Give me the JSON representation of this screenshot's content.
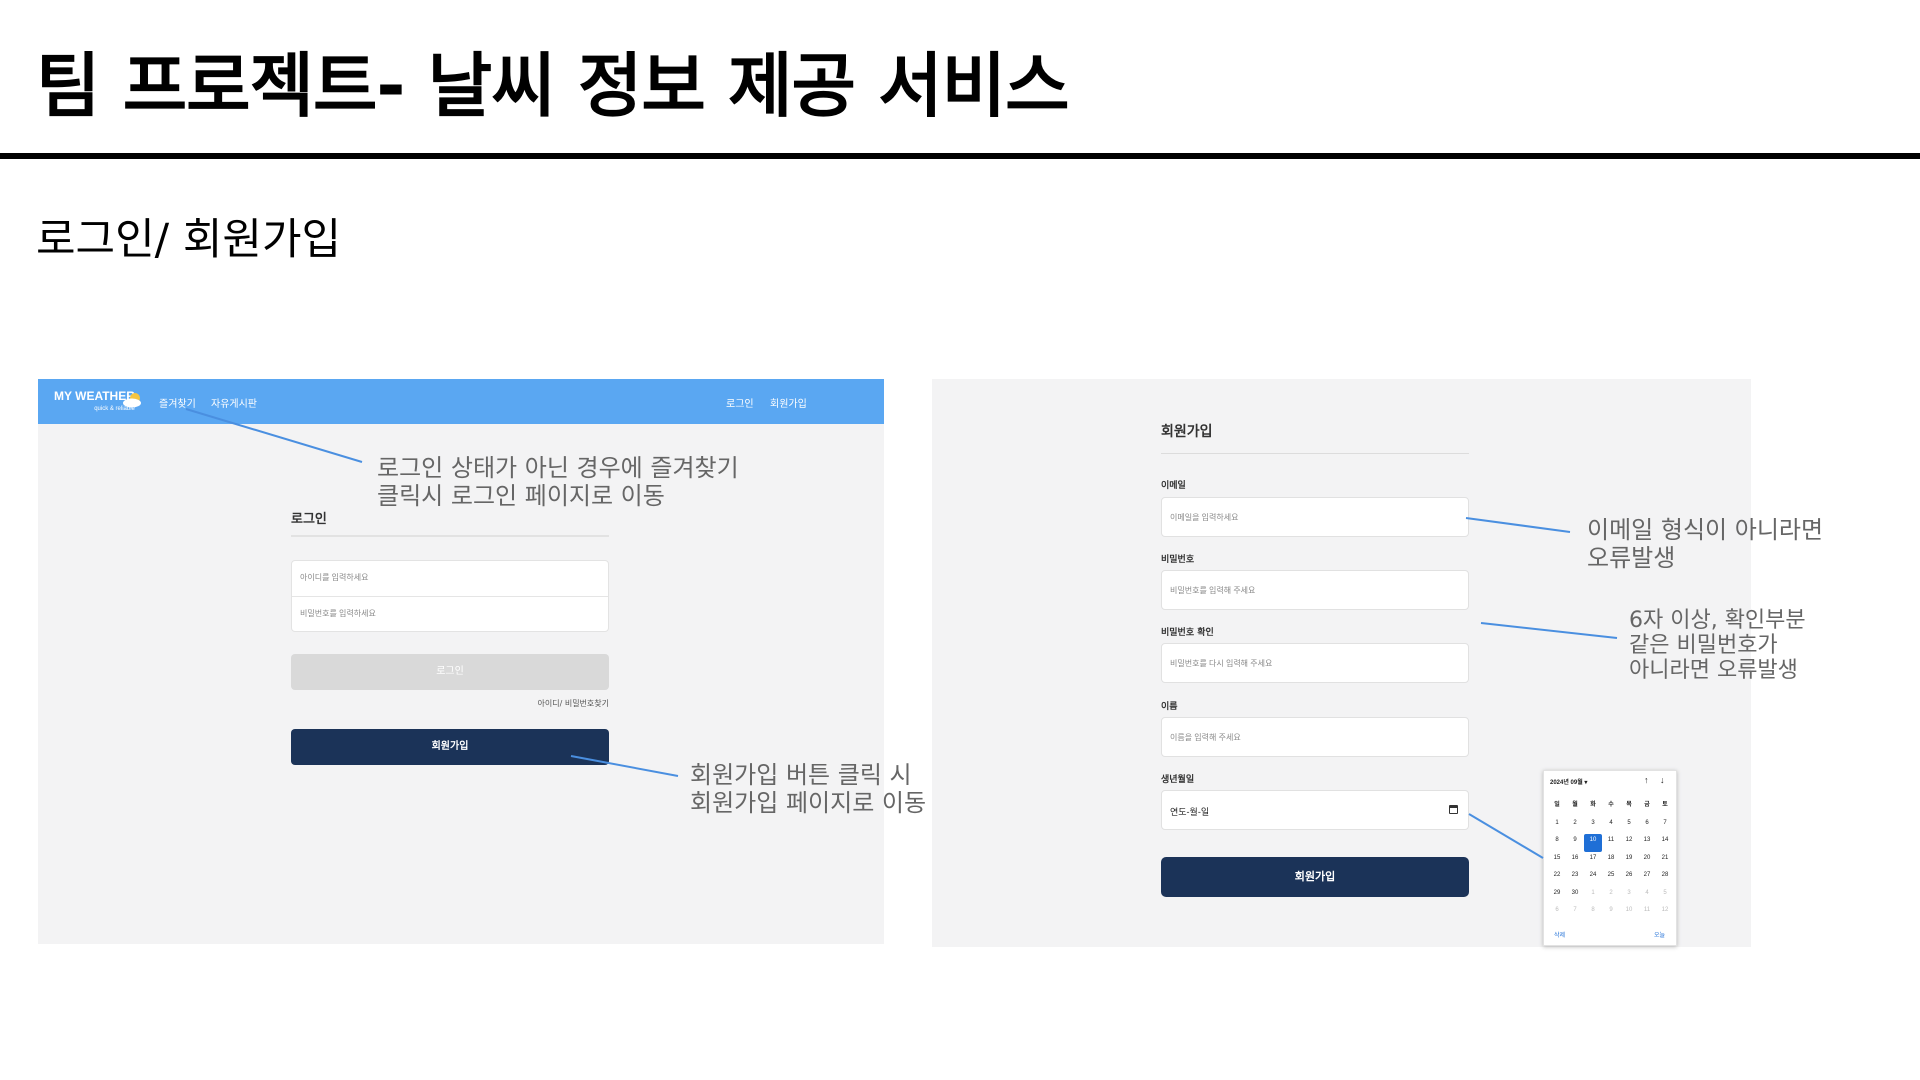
{
  "slide": {
    "title": "팀 프로젝트- 날씨 정보 제공 서비스",
    "subtitle": "로그인/ 회원가입"
  },
  "login_screen": {
    "nav": {
      "logo_title": "MY WEATHER",
      "logo_subtitle": "quick & reliable",
      "favorites": "즐겨찾기",
      "board": "자유게시판",
      "login": "로그인",
      "signup": "회원가입"
    },
    "heading": "로그인",
    "id_placeholder": "아이디를 입력하세요",
    "password_placeholder": "비밀번호를 입력하세요",
    "login_button": "로그인",
    "find_link": "아이디/ 비밀번호찾기",
    "signup_button": "회원가입"
  },
  "signup_screen": {
    "heading": "회원가입",
    "email_label": "이메일",
    "email_placeholder": "이메일을 입력하세요",
    "password_label": "비밀번호",
    "password_placeholder": "비밀번호를 입력해 주세요",
    "password_confirm_label": "비밀번호 확인",
    "password_confirm_placeholder": "비밀번호를 다시 입력해 주세요",
    "name_label": "이름",
    "name_placeholder": "이름을 입력해 주세요",
    "birth_label": "생년월일",
    "birth_value": "연도-월-일",
    "submit_button": "회원가입"
  },
  "calendar": {
    "header": "2024년 09월 ▾",
    "up": "↑",
    "down": "↓",
    "weekdays": [
      "일",
      "월",
      "화",
      "수",
      "목",
      "금",
      "토"
    ],
    "days": [
      "1",
      "2",
      "3",
      "4",
      "5",
      "6",
      "7",
      "8",
      "9",
      "10",
      "11",
      "12",
      "13",
      "14",
      "15",
      "16",
      "17",
      "18",
      "19",
      "20",
      "21",
      "22",
      "23",
      "24",
      "25",
      "26",
      "27",
      "28",
      "29",
      "30",
      "1",
      "2",
      "3",
      "4",
      "5",
      "6",
      "7",
      "8",
      "9",
      "10",
      "11",
      "12"
    ],
    "selected_day": "10",
    "clear": "삭제",
    "today": "오늘"
  },
  "annotations": {
    "favorites_note": "로그인 상태가 아닌 경우에 즐겨찾기\n클릭시 로그인 페이지로 이동",
    "signup_note": "회원가입 버튼 클릭 시\n회원가입 페이지로 이동",
    "email_note": "이메일 형식이 아니라면\n오류발생",
    "password_note": "6자 이상, 확인부분\n같은 비밀번호가\n아니라면 오류발생"
  },
  "colors": {
    "nav_blue": "#5aa7f2",
    "navy_button": "#1b3358",
    "connector": "#4a8fe0",
    "selected_day": "#1f6fd6"
  }
}
